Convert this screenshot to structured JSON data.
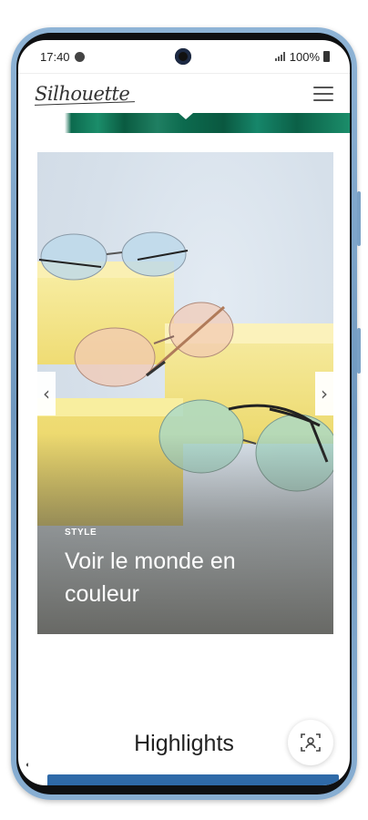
{
  "status_bar": {
    "time": "17:40",
    "battery": "100%"
  },
  "header": {
    "logo_text": "Silhouette",
    "menu_icon": "hamburger-menu-icon"
  },
  "hero": {
    "kicker": "STYLE",
    "headline": "Voir le monde en couleur",
    "prev_icon": "chevron-left-icon",
    "next_icon": "chevron-right-icon"
  },
  "section": {
    "title": "Highlights"
  },
  "floating": {
    "icon": "face-scan-icon"
  },
  "colors": {
    "banner_green": "#0c6a4e",
    "strip_blue": "#2f6aa8",
    "frame_blue": "#7aa1c6"
  }
}
